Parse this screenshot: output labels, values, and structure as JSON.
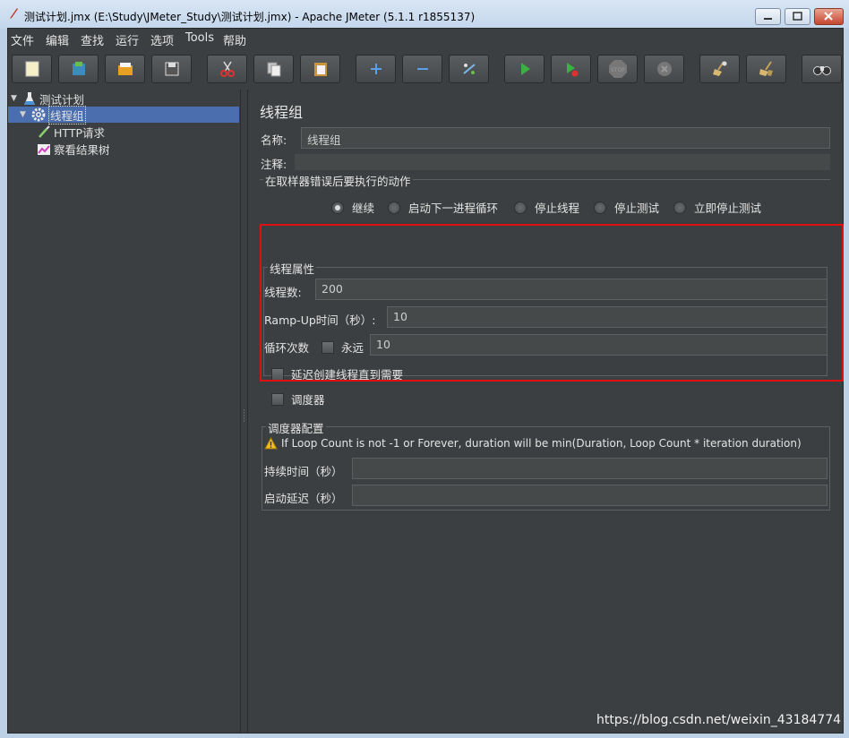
{
  "window": {
    "title": "测试计划.jmx (E:\\Study\\JMeter_Study\\测试计划.jmx) - Apache JMeter (5.1.1 r1855137)"
  },
  "menubar": {
    "items": [
      "文件",
      "编辑",
      "查找",
      "运行",
      "选项",
      "Tools",
      "帮助"
    ]
  },
  "toolbar": {
    "buttons": [
      "new-icon",
      "templates-icon",
      "open-icon",
      "save-icon",
      "cut-icon",
      "copy-icon",
      "paste-icon",
      "expand-icon",
      "collapse-icon",
      "toggle-icon",
      "start-icon",
      "start-no-pause-icon",
      "stop-icon",
      "shutdown-icon",
      "clear-icon",
      "clear-all-icon",
      "search-icon"
    ]
  },
  "tree": {
    "items": [
      {
        "label": "测试计划",
        "icon": "test-plan-icon",
        "level": 0
      },
      {
        "label": "线程组",
        "icon": "gear-icon",
        "level": 1,
        "selected": true
      },
      {
        "label": "HTTP请求",
        "icon": "pipette-icon",
        "level": 2
      },
      {
        "label": "察看结果树",
        "icon": "chart-icon",
        "level": 2
      }
    ]
  },
  "panel": {
    "title": "线程组",
    "name_label": "名称:",
    "name_value": "线程组",
    "comment_label": "注释:",
    "comment_value": "",
    "on_error": {
      "legend": "在取样器错误后要执行的动作",
      "options": [
        "继续",
        "启动下一进程循环",
        "停止线程",
        "停止测试",
        "立即停止测试"
      ],
      "selected": "继续"
    },
    "thread_props": {
      "legend": "线程属性",
      "threads_label": "线程数:",
      "threads_value": "200",
      "rampup_label": "Ramp-Up时间（秒）:",
      "rampup_value": "10",
      "loop_label": "循环次数",
      "forever_label": "永远",
      "forever_checked": false,
      "loop_value": "10",
      "delay_label": "延迟创建线程直到需要",
      "delay_checked": false,
      "scheduler_label": "调度器",
      "scheduler_checked": false
    },
    "scheduler_config": {
      "legend": "调度器配置",
      "warning": "If Loop Count is not -1 or Forever, duration will be min(Duration, Loop Count * iteration duration)",
      "duration_label": "持续时间（秒）",
      "duration_value": "",
      "delay_label": "启动延迟（秒）",
      "delay_value": ""
    }
  },
  "watermark": "https://blog.csdn.net/weixin_43184774",
  "colors": {
    "background": "#3c3f41",
    "selection": "#4b6eaf",
    "highlight_box": "#e01010"
  }
}
